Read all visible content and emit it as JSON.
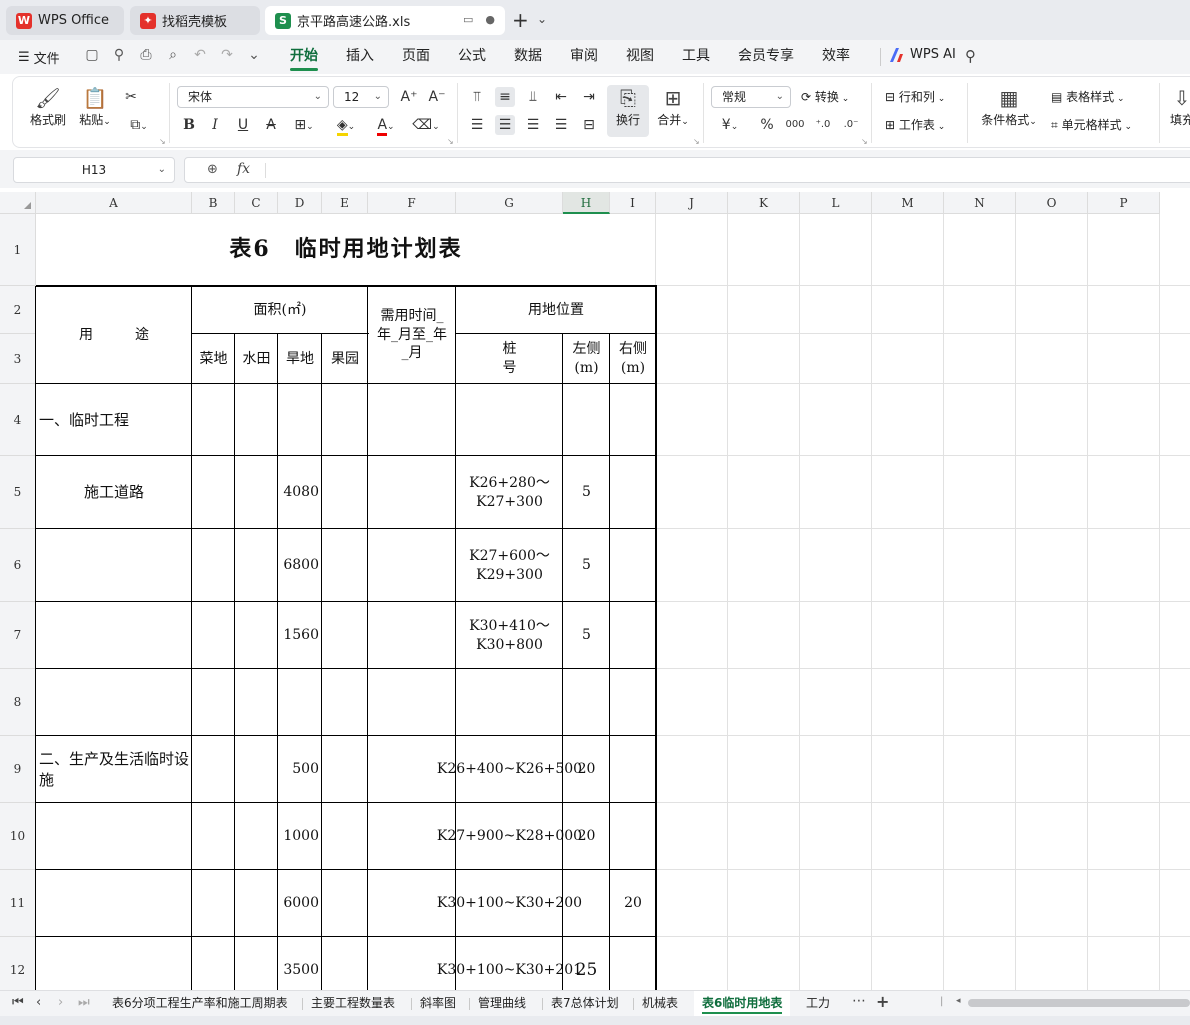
{
  "tabs": [
    {
      "label": "WPS Office",
      "logo": "W",
      "color": "#e4312b"
    },
    {
      "label": "找稻壳模板",
      "logo": "D",
      "color": "#e4312b"
    },
    {
      "label": "京平路高速公路.xls",
      "logo": "S",
      "color": "#1e8f4e"
    }
  ],
  "menu": {
    "file": "文件",
    "items": [
      "开始",
      "插入",
      "页面",
      "公式",
      "数据",
      "审阅",
      "视图",
      "工具",
      "会员专享",
      "效率"
    ],
    "active": "开始",
    "ai": "WPS AI"
  },
  "ribbon": {
    "format_painter": "格式刷",
    "paste": "粘贴",
    "font_name": "宋体",
    "font_size": "12",
    "wrap": "换行",
    "merge": "合并",
    "number_format": "常规",
    "convert": "转换",
    "row_col": "行和列",
    "worksheet": "工作表",
    "cond_format": "条件格式",
    "table_style": "表格样式",
    "cell_style": "单元格样式",
    "fill": "填充",
    "bold": "B",
    "italic": "I",
    "underline": "U",
    "currency": "¥",
    "percent": "%"
  },
  "formula_bar": {
    "name_box": "H13",
    "fx": "fx",
    "content": ""
  },
  "columns": [
    "A",
    "B",
    "C",
    "D",
    "E",
    "F",
    "G",
    "H",
    "I",
    "J",
    "K",
    "L",
    "M",
    "N",
    "O",
    "P"
  ],
  "selected_column": "H",
  "rows": [
    "1",
    "2",
    "3",
    "4",
    "5",
    "6",
    "7",
    "8",
    "9",
    "10",
    "11",
    "12"
  ],
  "sheet": {
    "title": "表6　临时用地计划表",
    "header": {
      "use": "用　　　途",
      "area": "面积(㎡)",
      "area_cols": [
        "菜地",
        "水田",
        "旱地",
        "果园"
      ],
      "time": "需用时间_年_月至_年_月",
      "location": "用地位置",
      "stake": "桩　号",
      "left": "左侧(m)",
      "right": "右侧(m)"
    },
    "rows": [
      {
        "use": "一、临时工程",
        "dry": "",
        "stake": "",
        "left": "",
        "right": ""
      },
      {
        "use": "施工道路",
        "dry": "4080",
        "stake": "K26+280～K27+300",
        "left": "5",
        "right": ""
      },
      {
        "use": "",
        "dry": "6800",
        "stake": "K27+600～K29+300",
        "left": "5",
        "right": ""
      },
      {
        "use": "",
        "dry": "1560",
        "stake": "K30+410～K30+800",
        "left": "5",
        "right": ""
      },
      {
        "use": "",
        "dry": "",
        "stake": "",
        "left": "",
        "right": ""
      },
      {
        "use": "二、生产及生活临时设施",
        "dry": "500",
        "stake": "K26+400~K26+500",
        "left": "20",
        "right": ""
      },
      {
        "use": "",
        "dry": "1000",
        "stake": "K27+900~K28+000",
        "left": "20",
        "right": ""
      },
      {
        "use": "",
        "dry": "6000",
        "stake": "K30+100~K30+200",
        "left": "",
        "right": "20"
      },
      {
        "use": "",
        "dry": "3500",
        "stake": "K30+100~K30+201",
        "left": "25",
        "right": ""
      }
    ]
  },
  "sheet_tabs": [
    "表6分项工程生产率和施工周期表",
    "主要工程数量表",
    "斜率图",
    "管理曲线",
    "表7总体计划",
    "机械表",
    "表6临时用地表",
    "工力"
  ],
  "active_sheet": "表6临时用地表",
  "more_tabs": "⋯",
  "add_tab": "+"
}
